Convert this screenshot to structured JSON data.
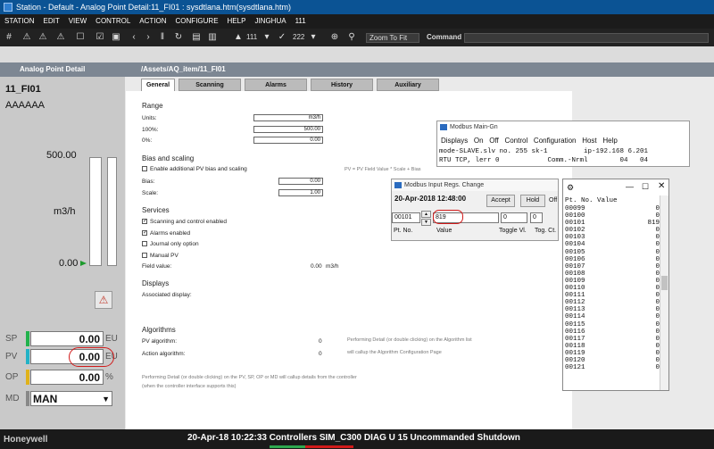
{
  "window": {
    "title": "Station - Default - Analog Point Detail:11_FI01 : sysdtlana.htm(sysdtlana.htm)"
  },
  "menu": [
    "STATION",
    "EDIT",
    "VIEW",
    "CONTROL",
    "ACTION",
    "CONFIGURE",
    "HELP",
    "JINGHUA",
    "111"
  ],
  "toolbar": {
    "page_value": "111",
    "page2_value": "222",
    "zoom_label": "Zoom To Fit",
    "command_label": "Command"
  },
  "header": {
    "left": "Analog Point Detail",
    "path": "/Assets/AQ_item/11_FI01"
  },
  "point": {
    "name": "11_FI01",
    "description": "AAAAAA",
    "scale_top": "500.00",
    "units": "m3/h",
    "scale_bottom": "0.00",
    "alarm_icon": "warning-icon",
    "sp_label": "SP",
    "sp_value": "0.00",
    "sp_unit": "EU",
    "pv_label": "PV",
    "pv_value": "0.00",
    "pv_unit": "EU",
    "op_label": "OP",
    "op_value": "0.00",
    "op_unit": "%",
    "md_label": "MD",
    "md_value": "MAN"
  },
  "tabs": [
    "General",
    "Scanning",
    "Alarms",
    "History",
    "Auxiliary"
  ],
  "general": {
    "range_title": "Range",
    "units_label": "Units:",
    "units_value": "m3/h",
    "hundred_label": "100%:",
    "hundred_value": "500.00",
    "zero_label": "0%:",
    "zero_value": "0.00",
    "bias_title": "Bias and scaling",
    "bias_enable": "Enable additional PV bias and scaling",
    "formula": "PV = PV Field Value * Scale + Bias",
    "bias_label": "Bias:",
    "bias_value": "0.00",
    "scale_label": "Scale:",
    "scale_value": "1.00",
    "services_title": "Services",
    "svc_scanning": "Scanning and control enabled",
    "svc_alarms": "Alarms enabled",
    "svc_journal": "Journal only option",
    "svc_manual": "Manual PV",
    "field_label": "Field value:",
    "field_value": "0.00",
    "field_unit": "m3/h",
    "displays_title": "Displays",
    "assoc_label": "Associated display:",
    "algo_title": "Algorithms",
    "pv_algo_label": "PV algorithm:",
    "pv_algo_value": "0",
    "act_algo_label": "Action algorithm:",
    "act_algo_value": "0",
    "algo_note1": "Performing Detail (or double clicking) on the Algorithm list",
    "algo_note2": "will callup the Algorithm Configuration Page",
    "bottom_note1": "Performing Detail (or double clicking) on the PV, SP, OP or MD will callup details from the controller",
    "bottom_note2": "(when the controller interface supports this)"
  },
  "mbmain": {
    "title": "Modbus Main-Gn",
    "menu": [
      "Displays",
      "On",
      "Off",
      "Control",
      "Configuration",
      "Host",
      "Help"
    ],
    "line1": "mode-SLAVE.slv no. 255 sk-1         ip-192.168 6.201",
    "line2": "RTU TCP, lerr 0            Comm.-Nrml        04   04"
  },
  "irc": {
    "title": "Modbus Input Regs. Change",
    "datetime": "20-Apr-2018 12:48:00",
    "accept": "Accept",
    "hold": "Hold",
    "off": "Off",
    "pt_value": "00101",
    "value": "819",
    "toggle_value": "0",
    "tog_value": "0",
    "pt_label": "Pt. No.",
    "value_label": "Value",
    "toggle_label": "Toggle Vl.",
    "tog_label": "Tog. Ct."
  },
  "vt": {
    "header": "Pt. No. Value",
    "rows": [
      [
        "00099",
        "0"
      ],
      [
        "00100",
        "0"
      ],
      [
        "00101",
        "819"
      ],
      [
        "00102",
        "0"
      ],
      [
        "00103",
        "0"
      ],
      [
        "00104",
        "0"
      ],
      [
        "00105",
        "0"
      ],
      [
        "00106",
        "0"
      ],
      [
        "00107",
        "0"
      ],
      [
        "00108",
        "0"
      ],
      [
        "00109",
        "0"
      ],
      [
        "00110",
        "0"
      ],
      [
        "00111",
        "0"
      ],
      [
        "00112",
        "0"
      ],
      [
        "00113",
        "0"
      ],
      [
        "00114",
        "0"
      ],
      [
        "00115",
        "0"
      ],
      [
        "00116",
        "0"
      ],
      [
        "00117",
        "0"
      ],
      [
        "00118",
        "0"
      ],
      [
        "00119",
        "0"
      ],
      [
        "00120",
        "0"
      ],
      [
        "00121",
        "0"
      ]
    ]
  },
  "status": {
    "text": "20-Apr-18  10:22:33  Controllers   SIM_C300   DIAG   U 15 Uncommanded Shutdown"
  },
  "colors": {
    "title_blue": "#0b5394",
    "header_gray": "#7d8793",
    "pv_highlight": "#d11a1a",
    "status_bar": "#1a1a1a"
  }
}
